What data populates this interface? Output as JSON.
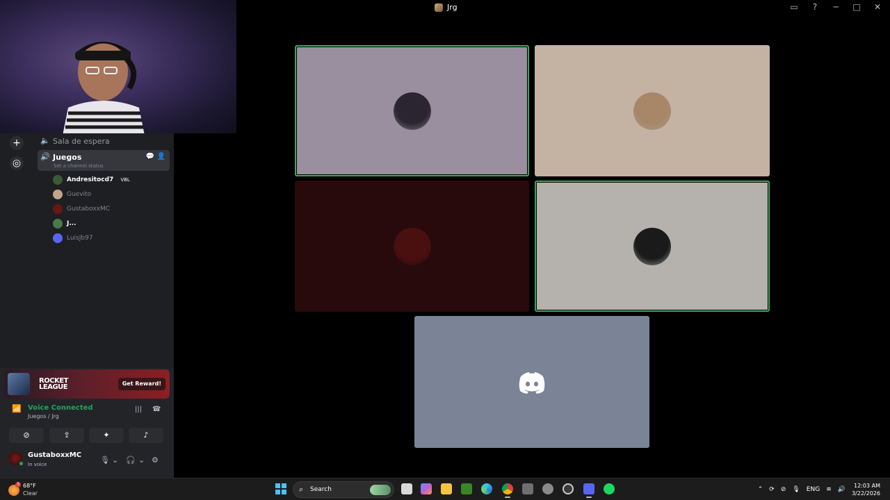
{
  "window": {
    "title": "Jrg"
  },
  "channels": {
    "waiting_room": "Sala de espera",
    "active": {
      "name": "Juegos",
      "status": "Set a channel status"
    }
  },
  "members": [
    {
      "name": "Andresitocd7",
      "badge": "VBL",
      "color": "#3a5a3a",
      "strong": true
    },
    {
      "name": "Guevito",
      "badge": "",
      "color": "#c2a48a",
      "strong": false
    },
    {
      "name": "GustaboxxMC",
      "badge": "",
      "color": "#6a1616",
      "strong": false
    },
    {
      "name": "J...",
      "badge": "",
      "color": "#4a7a4a",
      "strong": true
    },
    {
      "name": "LuisJb97",
      "badge": "",
      "color": "#5865f2",
      "strong": false
    }
  ],
  "promo": {
    "logo_line1": "ROCKET",
    "logo_line2": "LEAGUE",
    "button": "Get Reward!"
  },
  "voice": {
    "status": "Voice Connected",
    "path": "Juegos / Jrg"
  },
  "user": {
    "name": "GustaboxxMC",
    "status": "In voice"
  },
  "taskbar": {
    "weather_temp": "68°F",
    "weather_desc": "Clear",
    "weather_badge": "3",
    "search_placeholder": "Search",
    "language": "ENG",
    "time": "12:03 AM",
    "date": "3/22/2026"
  },
  "tiles": [
    {
      "bg": "#9a8f9e",
      "speaking": true,
      "avatar": "#2a2530"
    },
    {
      "bg": "#c4b2a3",
      "speaking": false,
      "avatar": "#a88768"
    },
    {
      "bg": "#290a0c",
      "speaking": false,
      "avatar": "#4a0f0f"
    },
    {
      "bg": "#b5b1ad",
      "speaking": true,
      "avatar": "#1a1a1a"
    },
    {
      "bg": "#7b8496",
      "speaking": false,
      "avatar": "discord"
    }
  ]
}
